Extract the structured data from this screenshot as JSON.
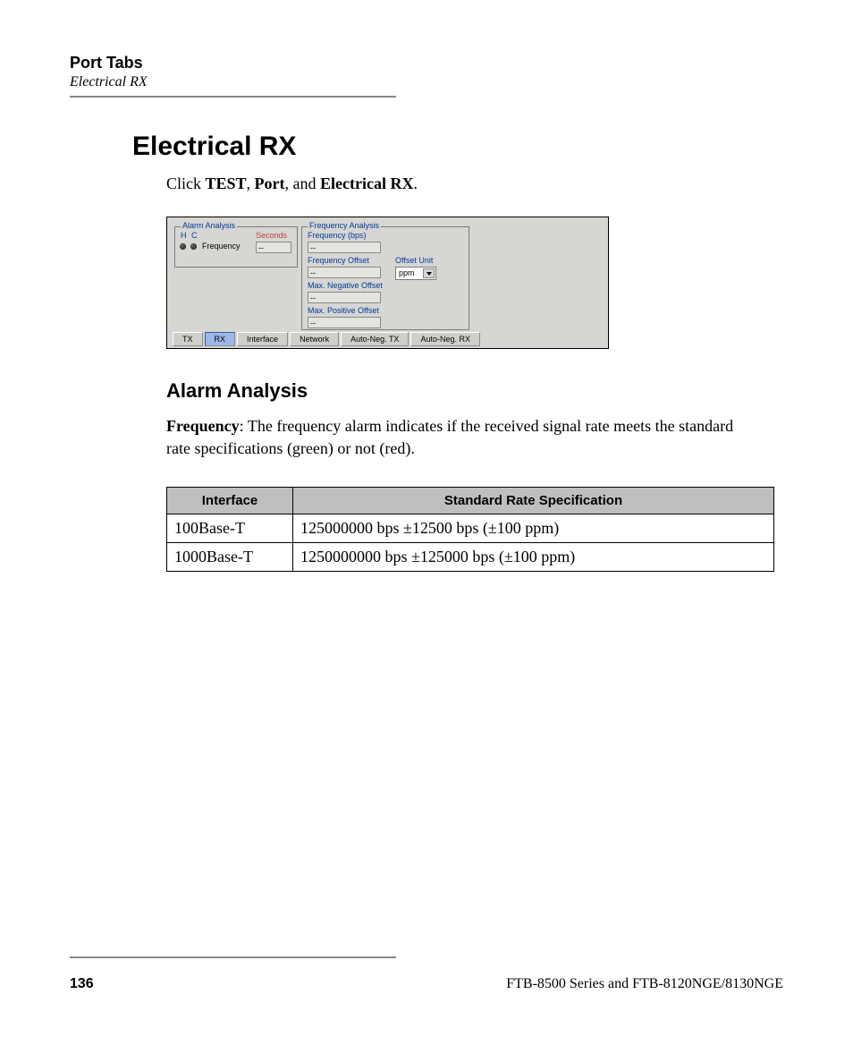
{
  "header": {
    "section": "Port Tabs",
    "subsection": "Electrical RX"
  },
  "main_title": "Electrical RX",
  "intro": {
    "prefix": "Click ",
    "b1": "TEST",
    "sep1": ", ",
    "b2": "Port",
    "sep2": ", and ",
    "b3": "Electrical RX",
    "suffix": "."
  },
  "screenshot": {
    "alarm": {
      "legend": "Alarm Analysis",
      "h": "H",
      "c": "C",
      "seconds": "Seconds",
      "frequency_label": "Frequency",
      "seconds_value": "--"
    },
    "freq": {
      "legend": "Frequency Analysis",
      "freq_bps_label": "Frequency (bps)",
      "freq_bps_value": "--",
      "freq_offset_label": "Frequency Offset",
      "freq_offset_value": "--",
      "offset_unit_label": "Offset Unit",
      "offset_unit_value": "ppm",
      "max_neg_label": "Max. Negative Offset",
      "max_neg_value": "--",
      "max_pos_label": "Max. Positive Offset",
      "max_pos_value": "--"
    },
    "tabs": [
      "TX",
      "RX",
      "Interface",
      "Network",
      "Auto-Neg. TX",
      "Auto-Neg. RX"
    ],
    "active_tab_index": 1
  },
  "section_heading": "Alarm Analysis",
  "para": {
    "b": "Frequency",
    "rest": ": The frequency alarm indicates if the received signal rate meets the standard rate specifications (green) or not (red)."
  },
  "table": {
    "headers": [
      "Interface",
      "Standard Rate Specification"
    ],
    "rows": [
      {
        "iface": "100Base-T",
        "spec": "125000000 bps ±12500 bps (±100 ppm)"
      },
      {
        "iface": "1000Base-T",
        "spec": "1250000000 bps ±125000 bps (±100 ppm)"
      }
    ]
  },
  "footer": {
    "page": "136",
    "product": "FTB-8500 Series and FTB-8120NGE/8130NGE"
  }
}
